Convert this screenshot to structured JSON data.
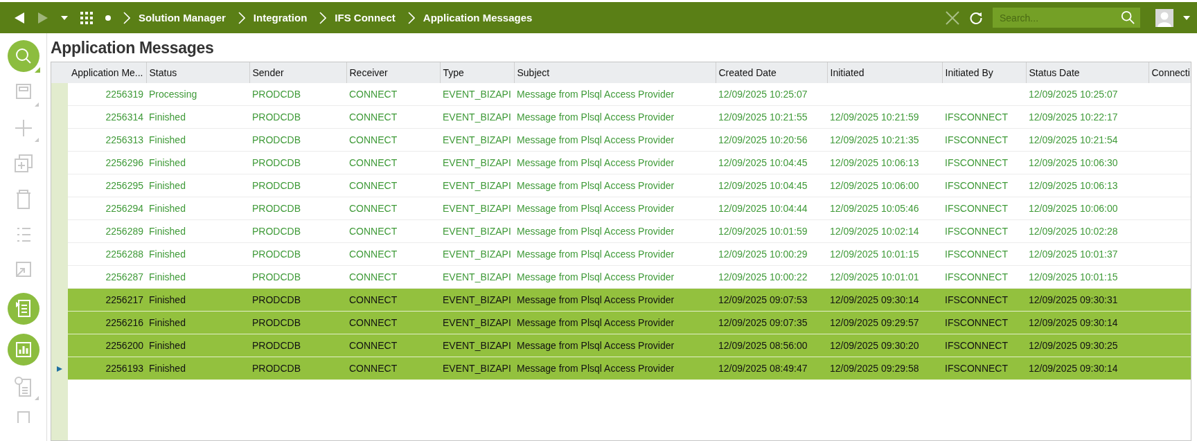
{
  "topbar": {
    "breadcrumbs": [
      {
        "label": "Solution Manager"
      },
      {
        "label": "Integration"
      },
      {
        "label": "IFS Connect"
      },
      {
        "label": "Application Messages"
      }
    ],
    "search": {
      "placeholder": "Search..."
    }
  },
  "page_title": "Application Messages",
  "table": {
    "columns": [
      "Application Me...",
      "Status",
      "Sender",
      "Receiver",
      "Type",
      "Subject",
      "Created Date",
      "Initiated",
      "Initiated By",
      "Status Date",
      "Connecti"
    ],
    "rows": [
      {
        "selected": false,
        "current": false,
        "cells": [
          "2256319",
          "Processing",
          "PRODCDB",
          "CONNECT",
          "EVENT_BIZAPI",
          "Message from Plsql Access Provider",
          "12/09/2025 10:25:07",
          null,
          null,
          "12/09/2025 10:25:07"
        ]
      },
      {
        "selected": false,
        "current": false,
        "cells": [
          "2256314",
          "Finished",
          "PRODCDB",
          "CONNECT",
          "EVENT_BIZAPI",
          "Message from Plsql Access Provider",
          "12/09/2025 10:21:55",
          "12/09/2025 10:21:59",
          "IFSCONNECT",
          "12/09/2025 10:22:17"
        ]
      },
      {
        "selected": false,
        "current": false,
        "cells": [
          "2256313",
          "Finished",
          "PRODCDB",
          "CONNECT",
          "EVENT_BIZAPI",
          "Message from Plsql Access Provider",
          "12/09/2025 10:20:56",
          "12/09/2025 10:21:35",
          "IFSCONNECT",
          "12/09/2025 10:21:54"
        ]
      },
      {
        "selected": false,
        "current": false,
        "cells": [
          "2256296",
          "Finished",
          "PRODCDB",
          "CONNECT",
          "EVENT_BIZAPI",
          "Message from Plsql Access Provider",
          "12/09/2025 10:04:45",
          "12/09/2025 10:06:13",
          "IFSCONNECT",
          "12/09/2025 10:06:30"
        ]
      },
      {
        "selected": false,
        "current": false,
        "cells": [
          "2256295",
          "Finished",
          "PRODCDB",
          "CONNECT",
          "EVENT_BIZAPI",
          "Message from Plsql Access Provider",
          "12/09/2025 10:04:45",
          "12/09/2025 10:06:00",
          "IFSCONNECT",
          "12/09/2025 10:06:13"
        ]
      },
      {
        "selected": false,
        "current": false,
        "cells": [
          "2256294",
          "Finished",
          "PRODCDB",
          "CONNECT",
          "EVENT_BIZAPI",
          "Message from Plsql Access Provider",
          "12/09/2025 10:04:44",
          "12/09/2025 10:05:46",
          "IFSCONNECT",
          "12/09/2025 10:06:00"
        ]
      },
      {
        "selected": false,
        "current": false,
        "cells": [
          "2256289",
          "Finished",
          "PRODCDB",
          "CONNECT",
          "EVENT_BIZAPI",
          "Message from Plsql Access Provider",
          "12/09/2025 10:01:59",
          "12/09/2025 10:02:14",
          "IFSCONNECT",
          "12/09/2025 10:02:28"
        ]
      },
      {
        "selected": false,
        "current": false,
        "cells": [
          "2256288",
          "Finished",
          "PRODCDB",
          "CONNECT",
          "EVENT_BIZAPI",
          "Message from Plsql Access Provider",
          "12/09/2025 10:00:29",
          "12/09/2025 10:01:15",
          "IFSCONNECT",
          "12/09/2025 10:01:37"
        ]
      },
      {
        "selected": false,
        "current": false,
        "cells": [
          "2256287",
          "Finished",
          "PRODCDB",
          "CONNECT",
          "EVENT_BIZAPI",
          "Message from Plsql Access Provider",
          "12/09/2025 10:00:22",
          "12/09/2025 10:01:01",
          "IFSCONNECT",
          "12/09/2025 10:01:15"
        ]
      },
      {
        "selected": true,
        "current": false,
        "cells": [
          "2256217",
          "Finished",
          "PRODCDB",
          "CONNECT",
          "EVENT_BIZAPI",
          "Message from Plsql Access Provider",
          "12/09/2025 09:07:53",
          "12/09/2025 09:30:14",
          "IFSCONNECT",
          "12/09/2025 09:30:31"
        ]
      },
      {
        "selected": true,
        "current": false,
        "cells": [
          "2256216",
          "Finished",
          "PRODCDB",
          "CONNECT",
          "EVENT_BIZAPI",
          "Message from Plsql Access Provider",
          "12/09/2025 09:07:35",
          "12/09/2025 09:29:57",
          "IFSCONNECT",
          "12/09/2025 09:30:14"
        ]
      },
      {
        "selected": true,
        "current": false,
        "cells": [
          "2256200",
          "Finished",
          "PRODCDB",
          "CONNECT",
          "EVENT_BIZAPI",
          "Message from Plsql Access Provider",
          "12/09/2025 08:56:00",
          "12/09/2025 09:30:20",
          "IFSCONNECT",
          "12/09/2025 09:30:25"
        ]
      },
      {
        "selected": true,
        "current": true,
        "cells": [
          "2256193",
          "Finished",
          "PRODCDB",
          "CONNECT",
          "EVENT_BIZAPI",
          "Message from Plsql Access Provider",
          "12/09/2025 08:49:47",
          "12/09/2025 09:29:58",
          "IFSCONNECT",
          "12/09/2025 09:30:14"
        ]
      }
    ]
  }
}
